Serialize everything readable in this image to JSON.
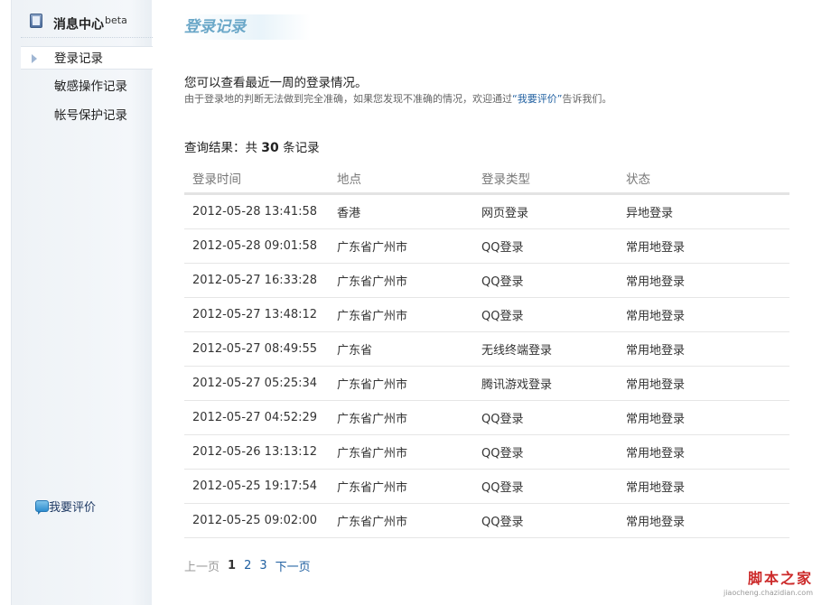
{
  "sidebar": {
    "title": "消息中心",
    "beta": "beta",
    "items": [
      {
        "label": "登录记录"
      },
      {
        "label": "敏感操作记录"
      },
      {
        "label": "帐号保护记录"
      }
    ],
    "feedback_label": "我要评价"
  },
  "main": {
    "title": "登录记录",
    "intro": "您可以查看最近一周的登录情况。",
    "note_before": "由于登录地的判断无法做到完全准确，如果您发现不准确的情况，欢迎通过",
    "note_link": "“我要评价”",
    "note_after": "告诉我们。",
    "result_prefix": "查询结果：共",
    "result_count": "30",
    "result_suffix": "条记录"
  },
  "table": {
    "headers": [
      "登录时间",
      "地点",
      "登录类型",
      "状态"
    ],
    "rows": [
      [
        "2012-05-28 13:41:58",
        "香港",
        "网页登录",
        "异地登录"
      ],
      [
        "2012-05-28 09:01:58",
        "广东省广州市",
        "QQ登录",
        "常用地登录"
      ],
      [
        "2012-05-27 16:33:28",
        "广东省广州市",
        "QQ登录",
        "常用地登录"
      ],
      [
        "2012-05-27 13:48:12",
        "广东省广州市",
        "QQ登录",
        "常用地登录"
      ],
      [
        "2012-05-27 08:49:55",
        "广东省",
        "无线终端登录",
        "常用地登录"
      ],
      [
        "2012-05-27 05:25:34",
        "广东省广州市",
        "腾讯游戏登录",
        "常用地登录"
      ],
      [
        "2012-05-27 04:52:29",
        "广东省广州市",
        "QQ登录",
        "常用地登录"
      ],
      [
        "2012-05-26 13:13:12",
        "广东省广州市",
        "QQ登录",
        "常用地登录"
      ],
      [
        "2012-05-25 19:17:54",
        "广东省广州市",
        "QQ登录",
        "常用地登录"
      ],
      [
        "2012-05-25 09:02:00",
        "广东省广州市",
        "QQ登录",
        "常用地登录"
      ]
    ]
  },
  "pager": {
    "prev": "上一页",
    "pages": [
      "1",
      "2",
      "3"
    ],
    "current": "1",
    "next": "下一页"
  },
  "watermark": {
    "title": "脚本之家",
    "url": "jiaocheng.chazidian.com"
  }
}
